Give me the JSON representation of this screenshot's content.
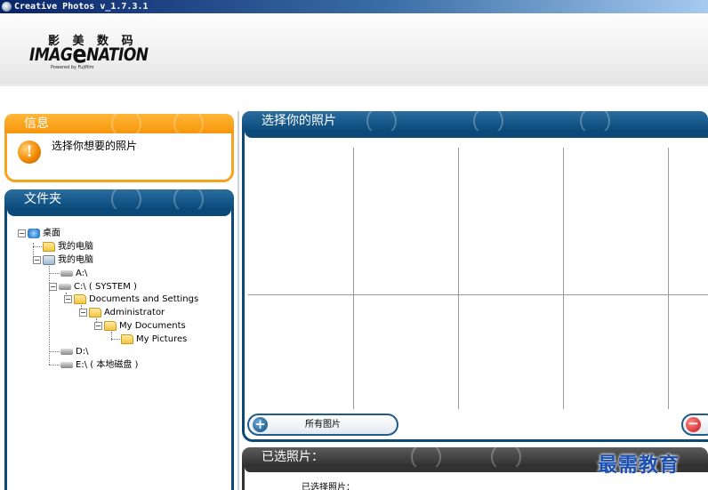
{
  "window": {
    "title": "Creative Photos v_1.7.3.1"
  },
  "brand": {
    "cn_name": "影 美 数 码",
    "logo_left": "IMAG",
    "logo_e": "e",
    "logo_right": "NATION",
    "powered_by": "Powered by Fujifilm"
  },
  "info_panel": {
    "title": "信息",
    "message": "选择你想要的照片",
    "icon": "warning-icon"
  },
  "folder_panel": {
    "title": "文件夹",
    "tree": [
      {
        "label": "桌面",
        "icon": "desktop-icon",
        "toggle": "−"
      },
      {
        "label": "我的电脑",
        "icon": "folder-icon",
        "toggle": ""
      },
      {
        "label": "我的电脑",
        "icon": "computer-icon",
        "toggle": "−"
      },
      {
        "label": "A:\\",
        "icon": "drive-icon",
        "toggle": ""
      },
      {
        "label": "C:\\ ( SYSTEM )",
        "icon": "drive-icon",
        "toggle": "−"
      },
      {
        "label": "Documents and Settings",
        "icon": "folder-icon",
        "toggle": "−"
      },
      {
        "label": "Administrator",
        "icon": "folder-icon",
        "toggle": "−"
      },
      {
        "label": "My Documents",
        "icon": "folder-icon",
        "toggle": "−"
      },
      {
        "label": "My Pictures",
        "icon": "folder-icon",
        "toggle": ""
      },
      {
        "label": "D:\\",
        "icon": "drive-icon",
        "toggle": ""
      },
      {
        "label": "E:\\ ( 本地磁盘 )",
        "icon": "drive-icon",
        "toggle": ""
      }
    ]
  },
  "choose_panel": {
    "title": "选择你的照片",
    "all_photos_label": "所有图片"
  },
  "selected_panel": {
    "title": "已选照片：",
    "selected_label": "已选择照片："
  },
  "watermark": "最需教育",
  "colors": {
    "orange": "#f7a31f",
    "navy": "#0b4a78",
    "dark": "#333333"
  }
}
